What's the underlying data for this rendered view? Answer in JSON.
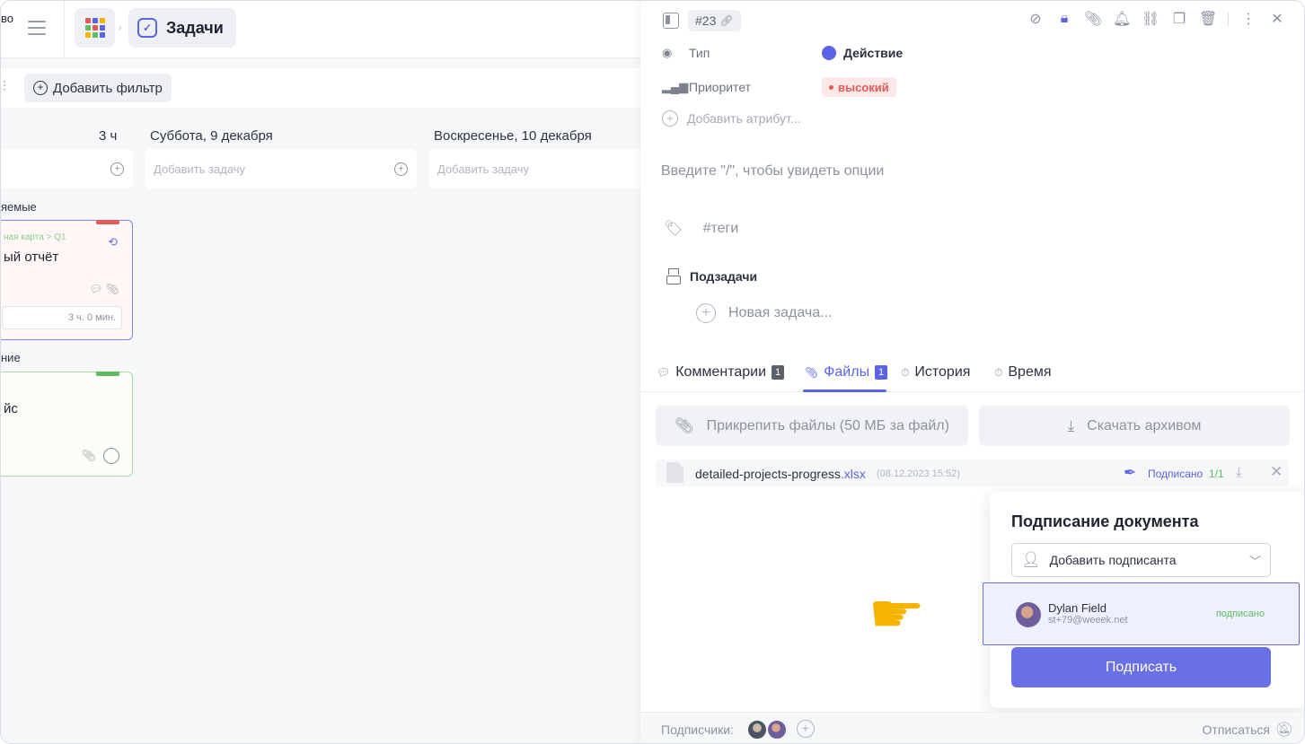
{
  "header": {
    "cut_text": "во",
    "section_title": "Задачи",
    "apps_colors": [
      "#e25b5b",
      "#5b63e6",
      "#f4b400",
      "#5fbb5f",
      "#e25b5b",
      "#5b63e6",
      "#f4b400",
      "#5fbb5f",
      "#5b63e6"
    ]
  },
  "filters": {
    "add_filter_label": "Добавить фильтр"
  },
  "board": {
    "columns": [
      {
        "title": "",
        "hours": "3 ч",
        "add_task_placeholder": ""
      },
      {
        "title": "Суббота, 9 декабря",
        "hours": "",
        "add_task_placeholder": "Добавить задачу"
      },
      {
        "title": "Воскресенье, 10 декабря",
        "hours": "",
        "add_task_placeholder": "Добавить задачу"
      }
    ],
    "groups": [
      {
        "label": "яемые"
      },
      {
        "label": "ние"
      }
    ],
    "cards": [
      {
        "path": "ная карта > Q1",
        "title": "ый отчёт",
        "time": "3 ч. 0 мин.",
        "color": "#e25b5b"
      },
      {
        "title": "йс",
        "color": "#5fbb5f"
      }
    ]
  },
  "task_panel": {
    "task_id": "#23",
    "attributes": [
      {
        "name": "Тип",
        "value": "Действие"
      },
      {
        "name": "Приоритет",
        "value": "высокий"
      }
    ],
    "add_attribute_label": "Добавить атрибут...",
    "description_placeholder": "Введите \"/\", чтобы увидеть опции",
    "tags_placeholder": "#теги",
    "subtasks_title": "Подзадачи",
    "new_subtask_label": "Новая задача...",
    "tabs": [
      {
        "label": "Комментарии",
        "count": "1"
      },
      {
        "label": "Файлы",
        "count": "1",
        "active": true
      },
      {
        "label": "История"
      },
      {
        "label": "Время"
      }
    ],
    "attach_button": "Прикрепить файлы (50 МБ за файл)",
    "download_archive_button": "Скачать архивом",
    "file": {
      "name": "detailed-projects-progress",
      "extension": ".xlsx",
      "date": "(08.12.2023 15:52)",
      "signed_label": "Подписано",
      "signed_count": "1/1"
    },
    "signing_popup": {
      "title": "Подписание документа",
      "add_signer_label": "Добавить подписанта",
      "signer": {
        "name": "Dylan Field",
        "email": "st+79@weeek.net",
        "status": "подписано"
      },
      "sign_button": "Подписать"
    },
    "footer": {
      "subscribers_label": "Подписчики:",
      "unsubscribe_label": "Отписаться"
    }
  },
  "colors": {
    "accent": "#5b63e6",
    "priority_high": "#e25b5b",
    "success": "#5fbb5f"
  }
}
